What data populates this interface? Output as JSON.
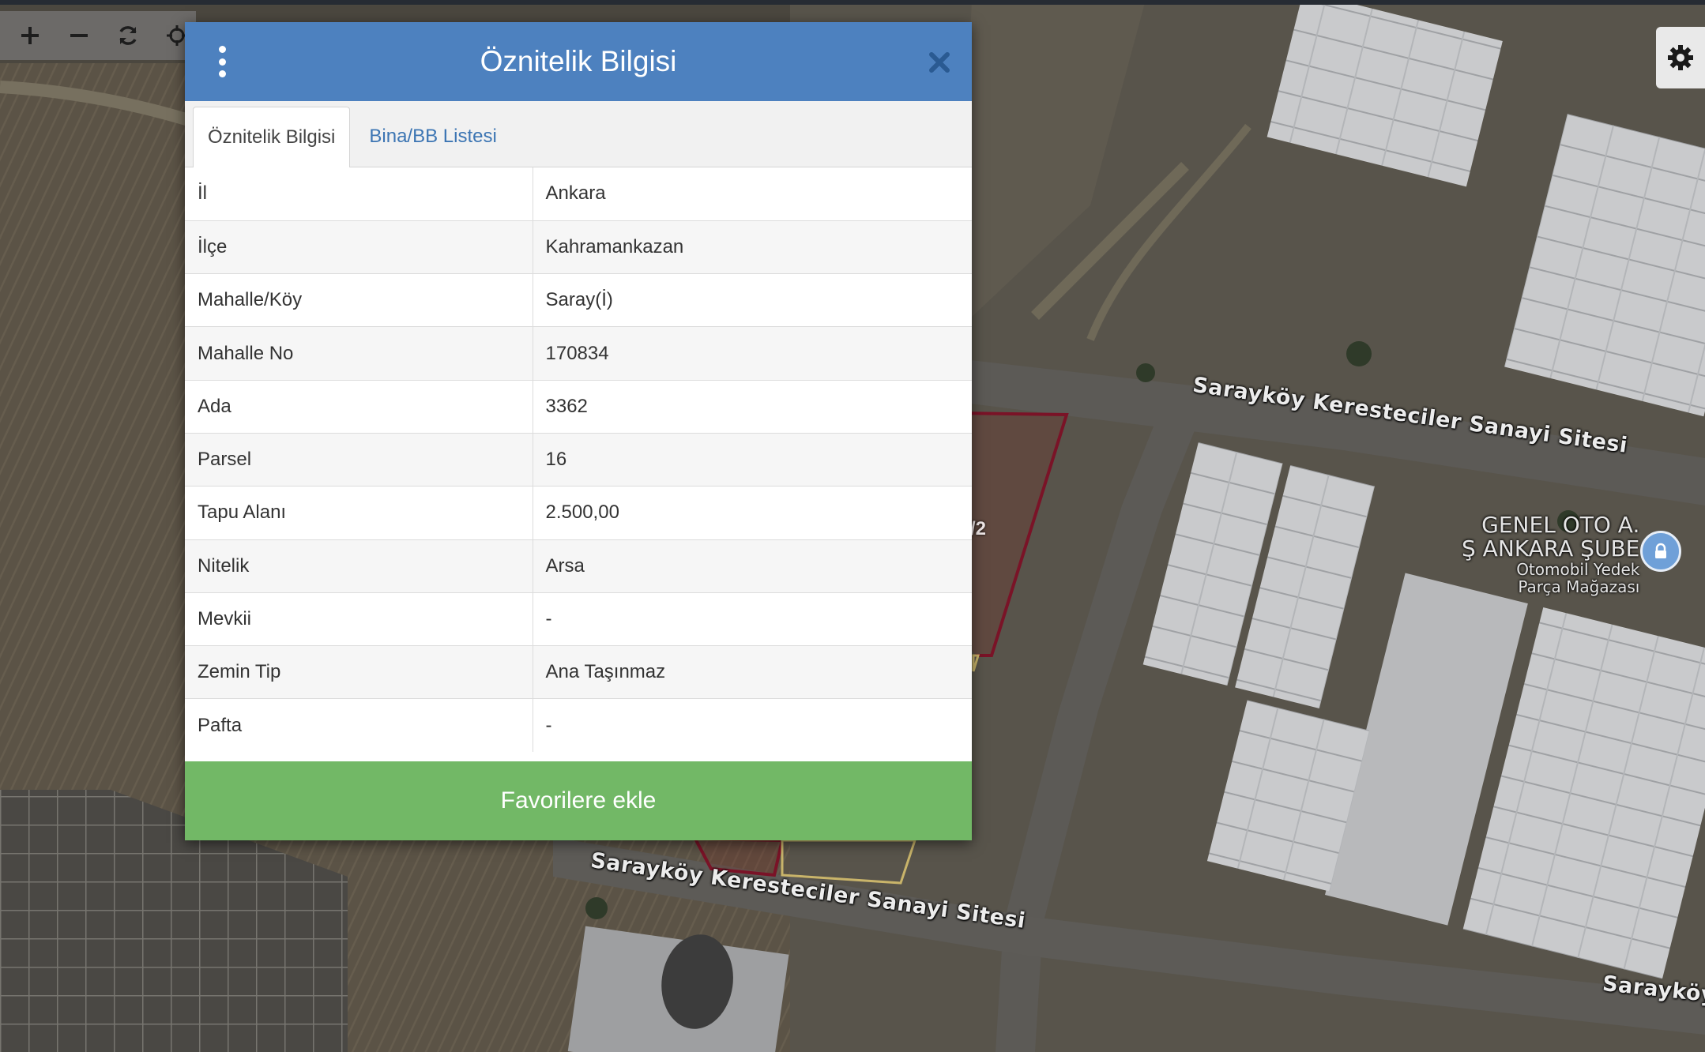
{
  "map": {
    "toolbar": {
      "zoom_in_icon": "plus-icon",
      "zoom_out_icon": "minus-icon",
      "refresh_icon": "refresh-icon",
      "locate_icon": "crosshair-icon"
    },
    "settings_icon": "gear-icon",
    "labels": {
      "road_upper": "Sarayköy Keresteciler Sanayi Sitesi",
      "road_lower": "Sarayköy Keresteciler Sanayi Sitesi",
      "road_corner": "Sarayköy",
      "poi_name_line1": "GENEL OTO A.",
      "poi_name_line2": "Ş ANKARA ŞUBE",
      "poi_type_line1": "Otomobil Yedek",
      "poi_type_line2": "Parça Mağazası",
      "parcel_tag": "/2"
    }
  },
  "panel": {
    "title": "Öznitelik Bilgisi",
    "menu_icon": "vertical-dots-icon",
    "close_icon": "close-icon",
    "tabs": [
      {
        "label": "Öznitelik Bilgisi",
        "active": true
      },
      {
        "label": "Bina/BB Listesi",
        "active": false
      }
    ],
    "rows": [
      {
        "key": "İl",
        "value": "Ankara"
      },
      {
        "key": "İlçe",
        "value": "Kahramankazan"
      },
      {
        "key": "Mahalle/Köy",
        "value": "Saray(İ)"
      },
      {
        "key": "Mahalle No",
        "value": "170834"
      },
      {
        "key": "Ada",
        "value": "3362"
      },
      {
        "key": "Parsel",
        "value": "16"
      },
      {
        "key": "Tapu Alanı",
        "value": "2.500,00"
      },
      {
        "key": "Nitelik",
        "value": "Arsa"
      },
      {
        "key": "Mevkii",
        "value": "-"
      },
      {
        "key": "Zemin Tip",
        "value": "Ana Taşınmaz"
      },
      {
        "key": "Pafta",
        "value": "-"
      }
    ],
    "favorite_button": "Favorilere ekle"
  },
  "colors": {
    "header": "#4d81bf",
    "tab_link": "#3c75b3",
    "favorite_button": "#72b866",
    "parcel_outline": "#7a1327",
    "parcel_outline_secondary": "#c9b46a"
  }
}
